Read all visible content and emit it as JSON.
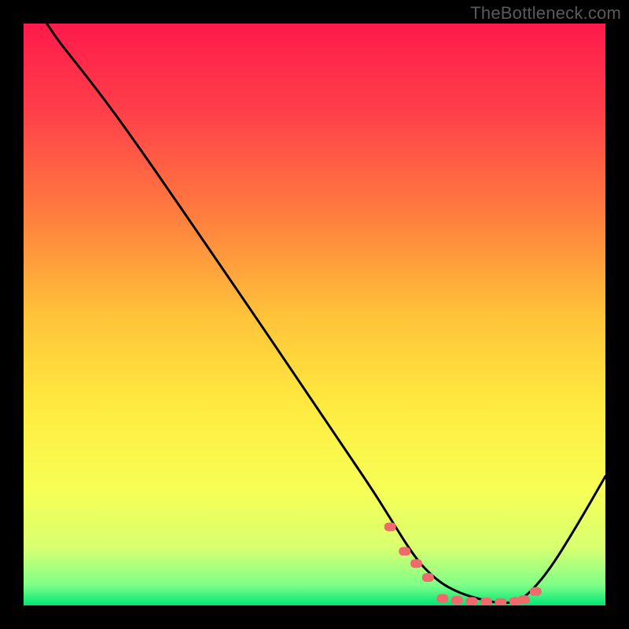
{
  "watermark": "TheBottleneck.com",
  "colors": {
    "frame_bg": "#000000",
    "curve": "#000000",
    "marker_fill": "#ef6a6a",
    "marker_stroke": "#cc4e4e",
    "gradient_stops": [
      {
        "offset": 0.0,
        "color": "#ff1a4b"
      },
      {
        "offset": 0.15,
        "color": "#ff3f4a"
      },
      {
        "offset": 0.32,
        "color": "#ff7a3f"
      },
      {
        "offset": 0.5,
        "color": "#ffc23a"
      },
      {
        "offset": 0.65,
        "color": "#ffe93f"
      },
      {
        "offset": 0.8,
        "color": "#f7ff55"
      },
      {
        "offset": 0.9,
        "color": "#d9ff70"
      },
      {
        "offset": 0.965,
        "color": "#7fff88"
      },
      {
        "offset": 1.0,
        "color": "#00e676"
      }
    ]
  },
  "chart_data": {
    "type": "line",
    "title": "",
    "xlabel": "",
    "ylabel": "",
    "xlim": [
      0,
      100
    ],
    "ylim": [
      0,
      100
    ],
    "series": [
      {
        "name": "bottleneck-curve",
        "x": [
          4,
          6,
          10,
          15,
          20,
          25,
          30,
          35,
          40,
          45,
          50,
          55,
          60,
          63,
          66,
          68,
          70,
          72,
          74,
          76,
          78,
          80,
          82,
          84,
          86,
          90,
          95,
          100
        ],
        "y": [
          100,
          97,
          92,
          85.5,
          78.5,
          71.3,
          64,
          56.7,
          49.4,
          42,
          34.6,
          27.2,
          19.8,
          15,
          10.2,
          7.4,
          5.3,
          3.7,
          2.6,
          1.8,
          1.2,
          0.7,
          0.4,
          0.5,
          1.2,
          5.5,
          13.5,
          22.2
        ]
      }
    ],
    "markers": {
      "name": "highlight-points",
      "shape": "rounded-rect",
      "x": [
        63,
        65.5,
        67.5,
        69.5,
        72,
        74.5,
        77,
        79.5,
        82,
        84.5,
        86,
        88
      ],
      "y": [
        13.5,
        9.3,
        7.2,
        4.8,
        1.2,
        0.9,
        0.7,
        0.6,
        0.5,
        0.7,
        1.0,
        2.4
      ]
    }
  }
}
